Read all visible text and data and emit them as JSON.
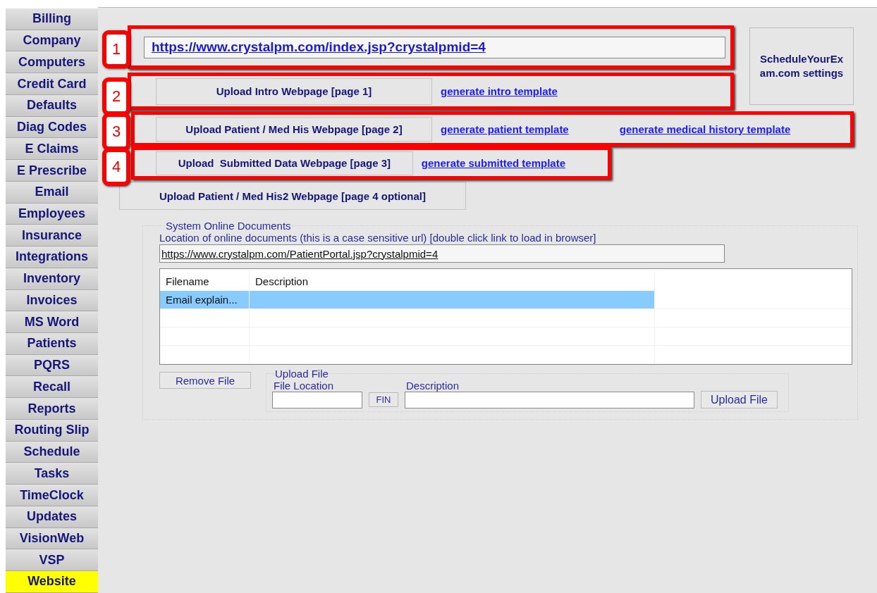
{
  "sidebar": {
    "items": [
      {
        "label": "Billing",
        "selected": false
      },
      {
        "label": "Company",
        "selected": false
      },
      {
        "label": "Computers",
        "selected": false
      },
      {
        "label": "Credit Card",
        "selected": false
      },
      {
        "label": "Defaults",
        "selected": false
      },
      {
        "label": "Diag Codes",
        "selected": false
      },
      {
        "label": "E Claims",
        "selected": false
      },
      {
        "label": "E Prescribe",
        "selected": false
      },
      {
        "label": "Email",
        "selected": false
      },
      {
        "label": "Employees",
        "selected": false
      },
      {
        "label": "Insurance",
        "selected": false
      },
      {
        "label": "Integrations",
        "selected": false
      },
      {
        "label": "Inventory",
        "selected": false
      },
      {
        "label": "Invoices",
        "selected": false
      },
      {
        "label": "MS Word",
        "selected": false
      },
      {
        "label": "Patients",
        "selected": false
      },
      {
        "label": "PQRS",
        "selected": false
      },
      {
        "label": "Recall",
        "selected": false
      },
      {
        "label": "Reports",
        "selected": false
      },
      {
        "label": "Routing Slip",
        "selected": false
      },
      {
        "label": "Schedule",
        "selected": false
      },
      {
        "label": "Tasks",
        "selected": false
      },
      {
        "label": "TimeClock",
        "selected": false
      },
      {
        "label": "Updates",
        "selected": false
      },
      {
        "label": "VisionWeb",
        "selected": false
      },
      {
        "label": "VSP",
        "selected": false
      },
      {
        "label": "Website",
        "selected": true
      }
    ]
  },
  "rows": [
    {
      "kind": "url",
      "callout": "1",
      "value": "https://www.crystalpm.com/index.jsp?crystalpmid=4"
    },
    {
      "kind": "upload",
      "callout": "2",
      "button": "Upload Intro Webpage [page 1]",
      "links": [
        "generate intro template"
      ]
    },
    {
      "kind": "upload",
      "callout": "3",
      "button": "Upload Patient / Med His Webpage [page 2]",
      "links": [
        "generate patient template",
        "generate medical history template"
      ]
    },
    {
      "kind": "upload",
      "callout": "4",
      "button": "Upload  Submitted Data Webpage [page 3]",
      "links": [
        "generate submitted template"
      ]
    },
    {
      "kind": "upload",
      "button": "Upload Patient / Med His2 Webpage [page 4 optional]"
    }
  ],
  "settings_button": "ScheduleYourExam.com settings",
  "documents": {
    "title": "System Online Documents",
    "location_label": "Location of online documents (this is a case sensitive url)  [double click link to load in browser]",
    "location_value": "https://www.crystalpm.com/PatientPortal.jsp?crystalpmid=4",
    "table": {
      "columns": [
        "Filename",
        "Description"
      ],
      "rows": [
        {
          "filename": "Email explain...",
          "selected": true
        }
      ]
    },
    "remove_button": "Remove File",
    "upload": {
      "title": "Upload File",
      "file_location_label": "File Location",
      "fin_button": "FIN",
      "description_label": "Description",
      "upload_button": "Upload File"
    }
  }
}
